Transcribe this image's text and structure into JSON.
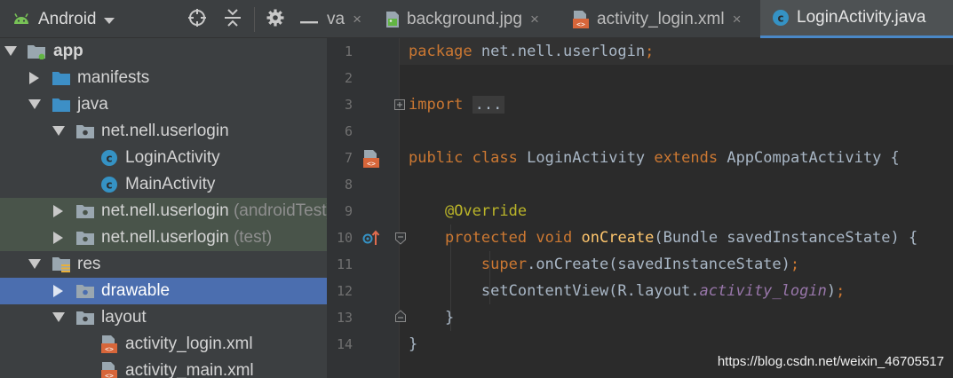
{
  "sidebar": {
    "view_label": "Android",
    "tree": [
      {
        "label": "app",
        "bold": true
      },
      {
        "label": "manifests"
      },
      {
        "label": "java"
      },
      {
        "label": "net.nell.userlogin"
      },
      {
        "label": "LoginActivity"
      },
      {
        "label": "MainActivity"
      },
      {
        "label": "net.nell.userlogin",
        "suffix": "(androidTest)"
      },
      {
        "label": "net.nell.userlogin",
        "suffix": "(test)"
      },
      {
        "label": "res"
      },
      {
        "label": "drawable"
      },
      {
        "label": "layout"
      },
      {
        "label": "activity_login.xml"
      },
      {
        "label": "activity_main.xml"
      }
    ]
  },
  "tabs": [
    {
      "label": "va"
    },
    {
      "label": "background.jpg"
    },
    {
      "label": "activity_login.xml"
    },
    {
      "label": "LoginActivity.java"
    }
  ],
  "tab_close_glyph": "×",
  "editor": {
    "line_numbers": [
      "1",
      "2",
      "3",
      "6",
      "7",
      "8",
      "9",
      "10",
      "11",
      "12",
      "13",
      "14"
    ],
    "code": {
      "l1": {
        "kw": "package",
        "rest": " net.nell.userlogin",
        "semi": ";"
      },
      "l3": {
        "kw": "import",
        "fold": "..."
      },
      "l7": {
        "kw1": "public",
        "kw2": "class",
        "name": "LoginActivity",
        "kw3": "extends",
        "parent": "AppCompatActivity {"
      },
      "l9": {
        "ann": "@Override"
      },
      "l10": {
        "kw1": "protected",
        "kw2": "void",
        "fn": "onCreate",
        "rest": "(Bundle savedInstanceState) {"
      },
      "l11": {
        "kw": "super",
        "rest": ".onCreate(savedInstanceState)",
        "semi": ";"
      },
      "l12": {
        "pre": "setContentView(R.layout.",
        "it": "activity_login",
        "post": ")",
        "semi": ";"
      },
      "l13": {
        "text": "}"
      },
      "l14": {
        "text": "}"
      }
    }
  },
  "watermark": "https://blog.csdn.net/weixin_46705517",
  "colors": {
    "selection": "#4b6eaf",
    "module_green": "#49544a",
    "keyword": "#cc7832",
    "annotation": "#bbb529",
    "method": "#ffc66d",
    "field_italic": "#9876aa",
    "class_icon": "#3592c4",
    "tab_underline": "#4a88c7"
  }
}
